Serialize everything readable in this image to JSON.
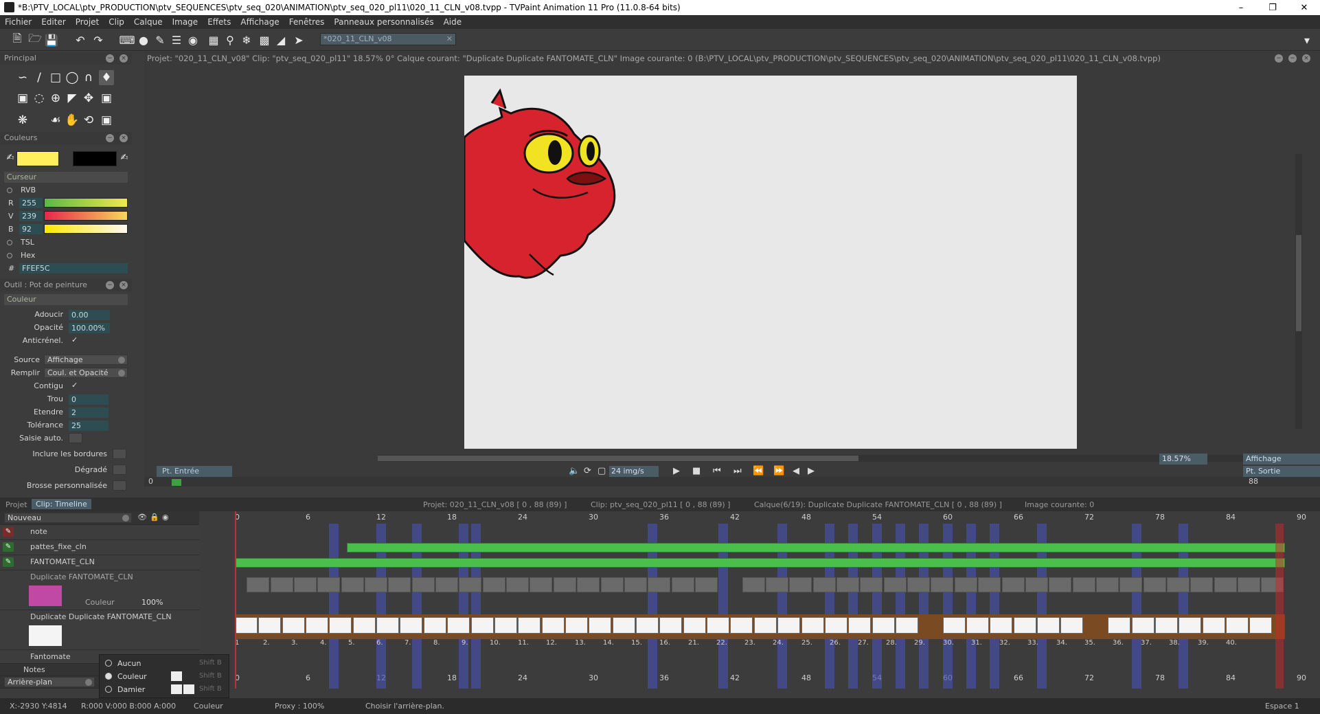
{
  "window": {
    "title": "*B:\\PTV_LOCAL\\ptv_PRODUCTION\\ptv_SEQUENCES\\ptv_seq_020\\ANIMATION\\ptv_seq_020_pl11\\020_11_CLN_v08.tvpp - TVPaint Animation 11 Pro (11.0.8-64 bits)"
  },
  "menu": [
    "Fichier",
    "Editer",
    "Projet",
    "Clip",
    "Calque",
    "Image",
    "Effets",
    "Affichage",
    "Fenêtres",
    "Panneaux personnalisés",
    "Aide"
  ],
  "toolbar": {
    "doc_tab": "*020_11_CLN_v08"
  },
  "panels": {
    "principal": "Principal",
    "couleurs": "Couleurs",
    "curseur": "Curseur",
    "color_modes": {
      "rvb": "RVB",
      "tsl": "TSL",
      "hex": "Hex"
    },
    "r_label": "R",
    "v_label": "V",
    "b_label": "B",
    "r": "255",
    "v": "239",
    "b": "92",
    "hex_prefix": "#",
    "hex": "FFEF5C",
    "tool_title": "Outil : Pot de peinture",
    "couleur_section": "Couleur",
    "adoucir_label": "Adoucir",
    "adoucir": "0.00",
    "opacite_label": "Opacité",
    "opacite": "100.00%",
    "anticrenel_label": "Anticrénel.",
    "source_label": "Source",
    "source": "Affichage",
    "remplir_label": "Remplir",
    "remplir": "Coul. et Opacité",
    "contigu_label": "Contigu",
    "trou_label": "Trou",
    "trou": "0",
    "etendre_label": "Etendre",
    "etendre": "2",
    "tolerance_label": "Tolérance",
    "tolerance": "25",
    "saisie_label": "Saisie auto.",
    "inclure_label": "Inclure les bordures",
    "degrade_label": "Dégradé",
    "brosse_label": "Brosse personnalisée"
  },
  "colors": {
    "primary": "#FFEF5C",
    "secondary": "#000000",
    "accent": "#4a5d66",
    "keyframe": "#4bbf4b"
  },
  "canvas": {
    "info": "Projet: \"020_11_CLN_v08\"  Clip: \"ptv_seq_020_pl11\"  18.57%  0°  Calque courant: \"Duplicate Duplicate FANTOMATE_CLN\"  Image courante: 0 (B:\\PTV_LOCAL\\ptv_PRODUCTION\\ptv_SEQUENCES\\ptv_seq_020\\ANIMATION\\ptv_seq_020_pl11\\020_11_CLN_v08.tvpp)"
  },
  "playback": {
    "entree": "Pt. Entrée",
    "sortie": "Pt. Sortie",
    "fps": "24 img/s",
    "zoom": "18.57%",
    "affichage": "Affichage",
    "start": "0",
    "end": "88"
  },
  "timeline": {
    "tab_projet": "Projet",
    "tab_clip": "Clip: Timeline",
    "info_projet": "Projet: 020_11_CLN_v08 [ 0 , 88  (89) ]",
    "info_clip": "Clip: ptv_seq_020_pl11 [ 0 , 88  (89) ]",
    "info_calque": "Calque(6/19): Duplicate Duplicate FANTOMATE_CLN [ 0 , 88  (89) ]",
    "info_image": "Image courante: 0",
    "nouveau": "Nouveau",
    "ticks": [
      "0",
      "6",
      "12",
      "18",
      "24",
      "30",
      "36",
      "42",
      "48",
      "54",
      "60",
      "66",
      "72",
      "78",
      "84",
      "90"
    ],
    "layers": [
      "note",
      "pattes_fixe_cln",
      "FANTOMATE_CLN",
      "Duplicate FANTOMATE_CLN",
      "Duplicate Duplicate FANTOMATE_CLN",
      "Fantomate"
    ],
    "layer_couleur": "Couleur",
    "layer_opacity": "100%",
    "notes": "Notes",
    "arriere_plan": "Arrière-plan",
    "frame_numbers": [
      "1",
      "2.",
      "3.",
      "4.",
      "5.",
      "6.",
      "7.",
      "8.",
      "9.",
      "10.",
      "11.",
      "12.",
      "13.",
      "14.",
      "15.",
      "16.",
      "21.",
      "22.",
      "23.",
      "24.",
      "25.",
      "26.",
      "27.",
      "28.",
      "29.",
      "30.",
      "31.",
      "32.",
      "33.",
      "34.",
      "35.",
      "36.",
      "37.",
      "38.",
      "39.",
      "40."
    ]
  },
  "popup": {
    "items": [
      "Aucun",
      "Couleur",
      "Damier"
    ],
    "shortcuts": [
      "Shift B",
      "Shift B",
      "Shift B"
    ]
  },
  "status": {
    "coords": "X:-2930  Y:4814",
    "rgba": "R:000 V:000 B:000 A:000",
    "couleur": "Couleur",
    "proxy": "Proxy : 100%",
    "hint": "Choisir l'arrière-plan.",
    "espace": "Espace 1"
  }
}
